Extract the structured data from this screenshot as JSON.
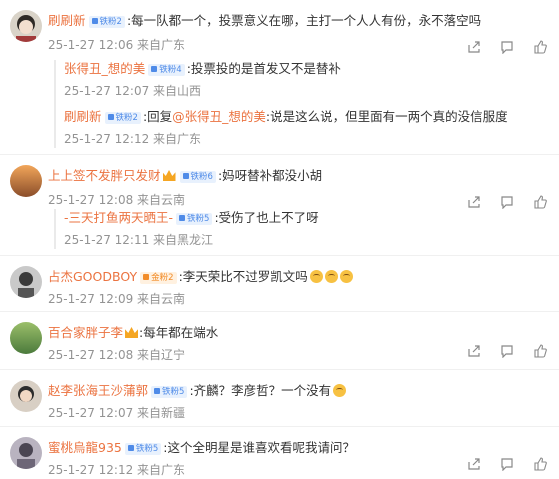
{
  "comments": [
    {
      "user": "刷刷新",
      "badge": "铁粉2",
      "text": ":每一队都一个，投票意义在哪，主打一个人人有份，永不落空吗",
      "meta": "25-1-27 12:06 来自广东",
      "replies": [
        {
          "user": "张得丑_想的美",
          "badge": "铁粉4",
          "text": ":投票投的是首发又不是替补",
          "meta": "25-1-27 12:07 来自山西"
        },
        {
          "user": "刷刷新",
          "badge": "铁粉2",
          "prefix": ":回复",
          "mention": "@张得丑_想的美",
          "text": ":说是这么说，但里面有一两个真的没信服度",
          "meta": "25-1-27 12:12 来自广东"
        }
      ]
    },
    {
      "user": "上上签不发胖只发财",
      "badge": "铁粉6",
      "text": ":妈呀替补都没小胡",
      "meta": "25-1-27 12:08 来自云南",
      "replies": [
        {
          "user": "-三天打鱼两天晒王-",
          "badge": "铁粉5",
          "text": ":受伤了也上不了呀",
          "meta": "25-1-27 12:11 来自黑龙江"
        }
      ]
    },
    {
      "user": "占杰GOODBOY",
      "badge": "金粉2",
      "text": ":李天荣比不过罗凯文吗",
      "meta": "25-1-27 12:09 来自云南"
    },
    {
      "user": "百合家胖子李",
      "badge": "",
      "text": ":每年都在端水",
      "meta": "25-1-27 12:08 来自辽宁"
    },
    {
      "user": "赵李张海王沙蒲郭",
      "badge": "铁粉5",
      "text": ":齐麟？李彦哲？一个没有",
      "meta": "25-1-27 12:07 来自新疆"
    },
    {
      "user": "蜜桃烏龍935",
      "badge": "铁粉5",
      "text": ":这个全明星是谁喜欢看呢我请问？",
      "meta": "25-1-27 12:12 来自广东"
    }
  ],
  "colors": {
    "username": "#eb7340",
    "meta": "#939393",
    "badge": "#4f8be8"
  },
  "icons": [
    "share-icon",
    "comment-icon",
    "like-icon"
  ]
}
